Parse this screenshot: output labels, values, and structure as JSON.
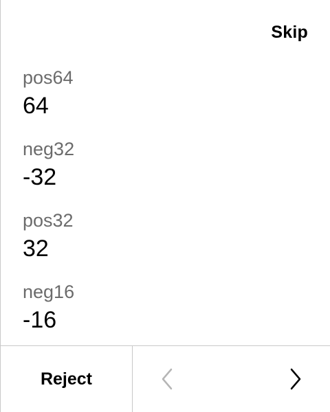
{
  "header": {
    "skip_label": "Skip"
  },
  "fields": [
    {
      "label": "pos64",
      "value": "64"
    },
    {
      "label": "neg32",
      "value": "-32"
    },
    {
      "label": "pos32",
      "value": "32"
    },
    {
      "label": "neg16",
      "value": "-16"
    }
  ],
  "footer": {
    "reject_label": "Reject",
    "prev_icon": "chevron-left-icon",
    "next_icon": "chevron-right-icon"
  },
  "colors": {
    "label_text": "#6b6b6b",
    "value_text": "#000000",
    "divider": "#c8c8c8",
    "disabled_icon": "#b5b5b5",
    "enabled_icon": "#000000"
  }
}
